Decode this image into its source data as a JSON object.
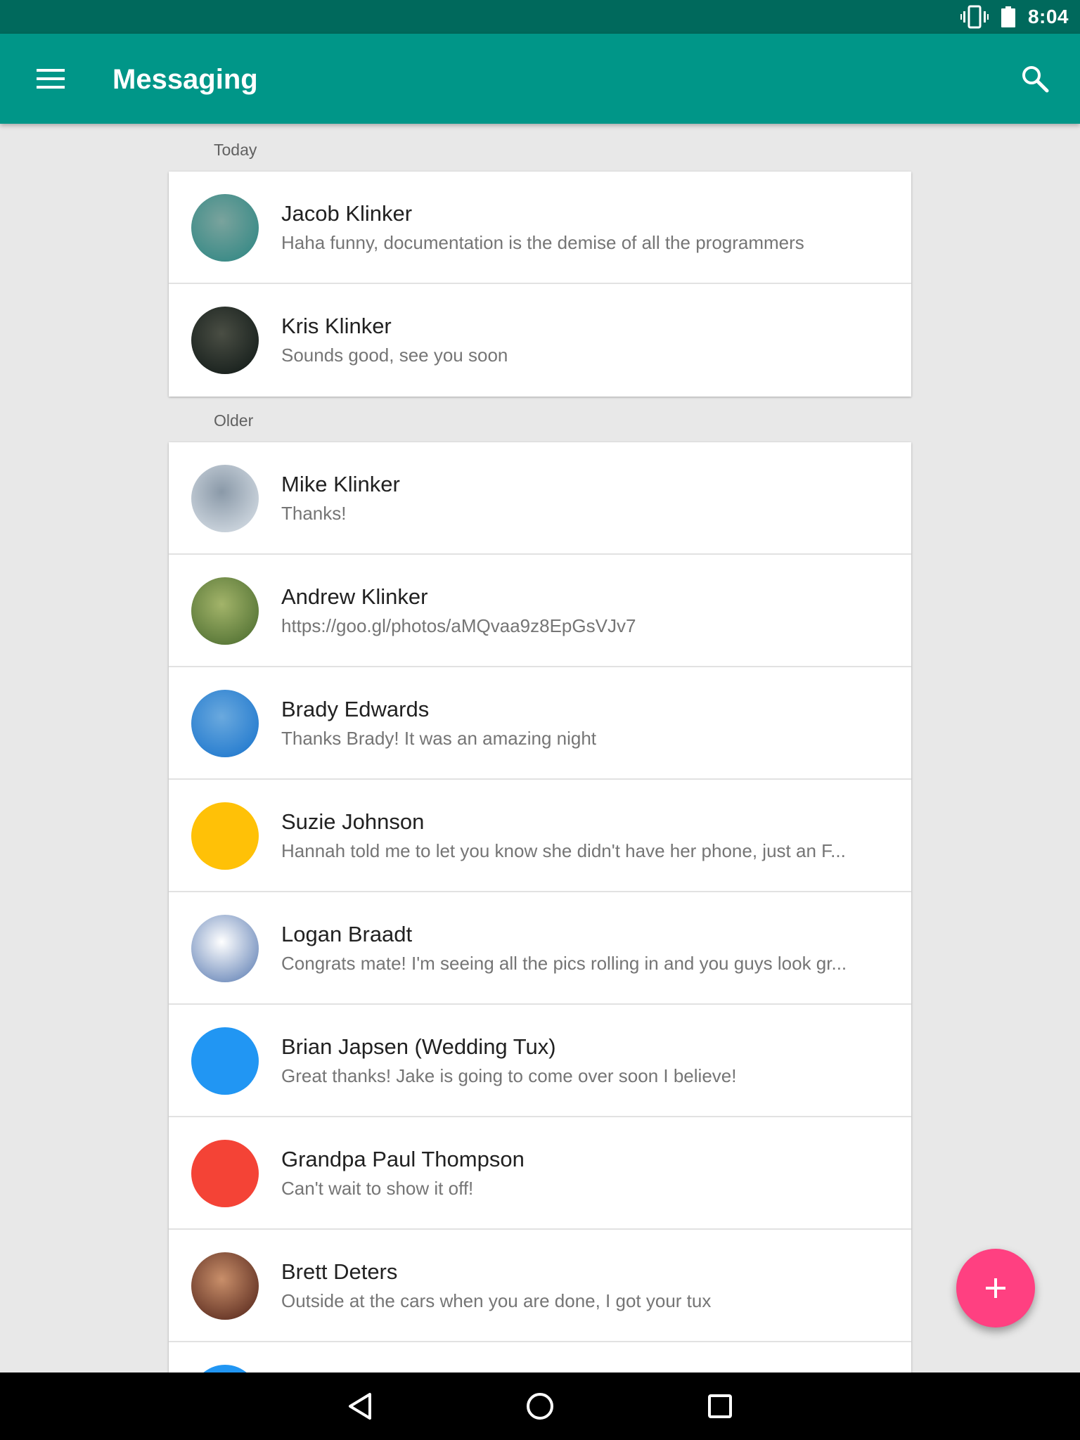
{
  "status_bar": {
    "time": "8:04"
  },
  "app_bar": {
    "title": "Messaging"
  },
  "sections": [
    {
      "header": "Today",
      "conversations": [
        {
          "name": "Jacob Klinker",
          "snippet": "Haha funny, documentation is the demise of all the programmers",
          "avatar": "photo",
          "avatar_colors": [
            "#3d8c88",
            "#7aa39d"
          ]
        },
        {
          "name": "Kris Klinker",
          "snippet": "Sounds good, see you soon",
          "avatar": "photo",
          "avatar_colors": [
            "#1c2420",
            "#4a4e44"
          ]
        }
      ]
    },
    {
      "header": "Older",
      "conversations": [
        {
          "name": "Mike Klinker",
          "snippet": "Thanks!",
          "avatar": "photo",
          "avatar_colors": [
            "#c9d2db",
            "#8a99a8"
          ]
        },
        {
          "name": "Andrew Klinker",
          "snippet": "https://goo.gl/photos/aMQvaa9z8EpGsVJv7",
          "avatar": "photo",
          "avatar_colors": [
            "#5c7a3a",
            "#a3b46a"
          ]
        },
        {
          "name": "Brady Edwards",
          "snippet": "Thanks Brady! It was an amazing night",
          "avatar": "photo",
          "avatar_colors": [
            "#2a7fd0",
            "#6aa9de"
          ]
        },
        {
          "name": "Suzie Johnson",
          "snippet": "Hannah told me to let you know she didn't have her phone, just an F...",
          "avatar": "color",
          "avatar_colors": [
            "#ffc107"
          ]
        },
        {
          "name": "Logan Braadt",
          "snippet": "Congrats mate! I'm seeing all the pics rolling in and you guys look gr...",
          "avatar": "photo",
          "avatar_colors": [
            "#7d97c2",
            "#ffffff"
          ]
        },
        {
          "name": "Brian Japsen (Wedding Tux)",
          "snippet": "Great thanks! Jake is going to come over soon I believe!",
          "avatar": "color",
          "avatar_colors": [
            "#2196f3"
          ]
        },
        {
          "name": "Grandpa Paul Thompson",
          "snippet": "Can't wait to show it off!",
          "avatar": "color",
          "avatar_colors": [
            "#f44336"
          ]
        },
        {
          "name": "Brett Deters",
          "snippet": "Outside at the cars when you are done, I got your tux",
          "avatar": "photo",
          "avatar_colors": [
            "#6b3a2a",
            "#c98f6a"
          ]
        },
        {
          "name": "",
          "snippet": "",
          "avatar": "color",
          "avatar_colors": [
            "#2196f3"
          ]
        }
      ]
    }
  ],
  "colors": {
    "status_bar": "#00695c",
    "app_bar": "#009688",
    "fab": "#ff4081",
    "background": "#e8e8e8"
  },
  "icons": {
    "menu": "menu-icon",
    "search": "search-icon",
    "vibrate": "vibrate-icon",
    "battery": "battery-icon",
    "fab": "plus-icon",
    "nav_back": "back-triangle-icon",
    "nav_home": "home-circle-icon",
    "nav_recents": "recents-square-icon"
  }
}
